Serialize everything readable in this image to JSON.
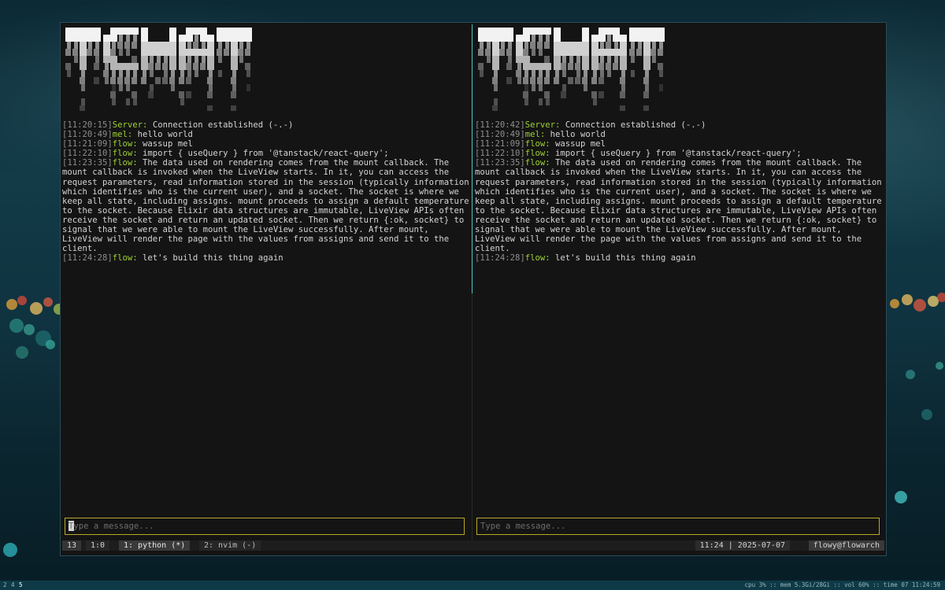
{
  "app": {
    "logo_text": "TCHAT"
  },
  "panes": [
    {
      "messages": [
        {
          "time": "[11:20:15]",
          "nick": "Server:",
          "text": " Connection established (-.-)"
        },
        {
          "time": "[11:20:49]",
          "nick": "mel:",
          "text": " hello world"
        },
        {
          "time": "[11:21:09]",
          "nick": "flow:",
          "text": " wassup mel"
        },
        {
          "time": "[11:22:10]",
          "nick": "flow:",
          "text": " import { useQuery } from '@tanstack/react-query';"
        },
        {
          "time": "[11:23:35]",
          "nick": "flow:",
          "text": " The data used on rendering comes from the mount callback. The mount callback is invoked when the LiveView starts. In it, you can access the request parameters, read information stored in the session (typically information which identifies who is the current user), and a socket. The socket is where we keep all state, including assigns. mount proceeds to assign a default temperature to the socket. Because Elixir data structures are immutable, LiveView APIs often receive the socket and return an updated socket. Then we return {:ok, socket} to signal that we were able to mount the LiveView successfully. After mount, LiveView will render the page with the values from assigns and send it to the client."
        },
        {
          "time": "[11:24:28]",
          "nick": "flow:",
          "text": " let's build this thing again"
        }
      ],
      "input": {
        "placeholder": "Type a message...",
        "value": ""
      }
    },
    {
      "messages": [
        {
          "time": "[11:20:42]",
          "nick": "Server:",
          "text": " Connection established (-.-)"
        },
        {
          "time": "[11:20:49]",
          "nick": "mel:",
          "text": " hello world"
        },
        {
          "time": "[11:21:09]",
          "nick": "flow:",
          "text": " wassup mel"
        },
        {
          "time": "[11:22:10]",
          "nick": "flow:",
          "text": " import { useQuery } from '@tanstack/react-query';"
        },
        {
          "time": "[11:23:35]",
          "nick": "flow:",
          "text": " The data used on rendering comes from the mount callback. The mount callback is invoked when the LiveView starts. In it, you can access the request parameters, read information stored in the session (typically information which identifies who is the current user), and a socket. The socket is where we keep all state, including assigns. mount proceeds to assign a default temperature to the socket. Because Elixir data structures are immutable, LiveView APIs often receive the socket and return an updated socket. Then we return {:ok, socket} to signal that we were able to mount the LiveView successfully. After mount, LiveView will render the page with the values from assigns and send it to the client."
        },
        {
          "time": "[11:24:28]",
          "nick": "flow:",
          "text": " let's build this thing again"
        }
      ],
      "input": {
        "placeholder": "Type a message...",
        "value": ""
      }
    }
  ],
  "tmux": {
    "session": "13",
    "pane": "1:0",
    "windows": [
      {
        "label": "1: python (*)",
        "active": true
      },
      {
        "label": "2: nvim (-)",
        "active": false
      }
    ],
    "datetime": "11:24 | 2025-07-07",
    "host": "flowy@flowarch"
  },
  "desktop": {
    "workspaces": [
      "2",
      "4",
      "5"
    ],
    "active_workspace": "5",
    "system_status": "cpu 3% :: mem 5.3Gi/28Gi :: vol 60% :: time 07 11:24:59"
  },
  "colors": {
    "accent": "#47c8c8",
    "nick": "#9dd133",
    "input_border": "#b9a92a",
    "background": "#141414"
  }
}
